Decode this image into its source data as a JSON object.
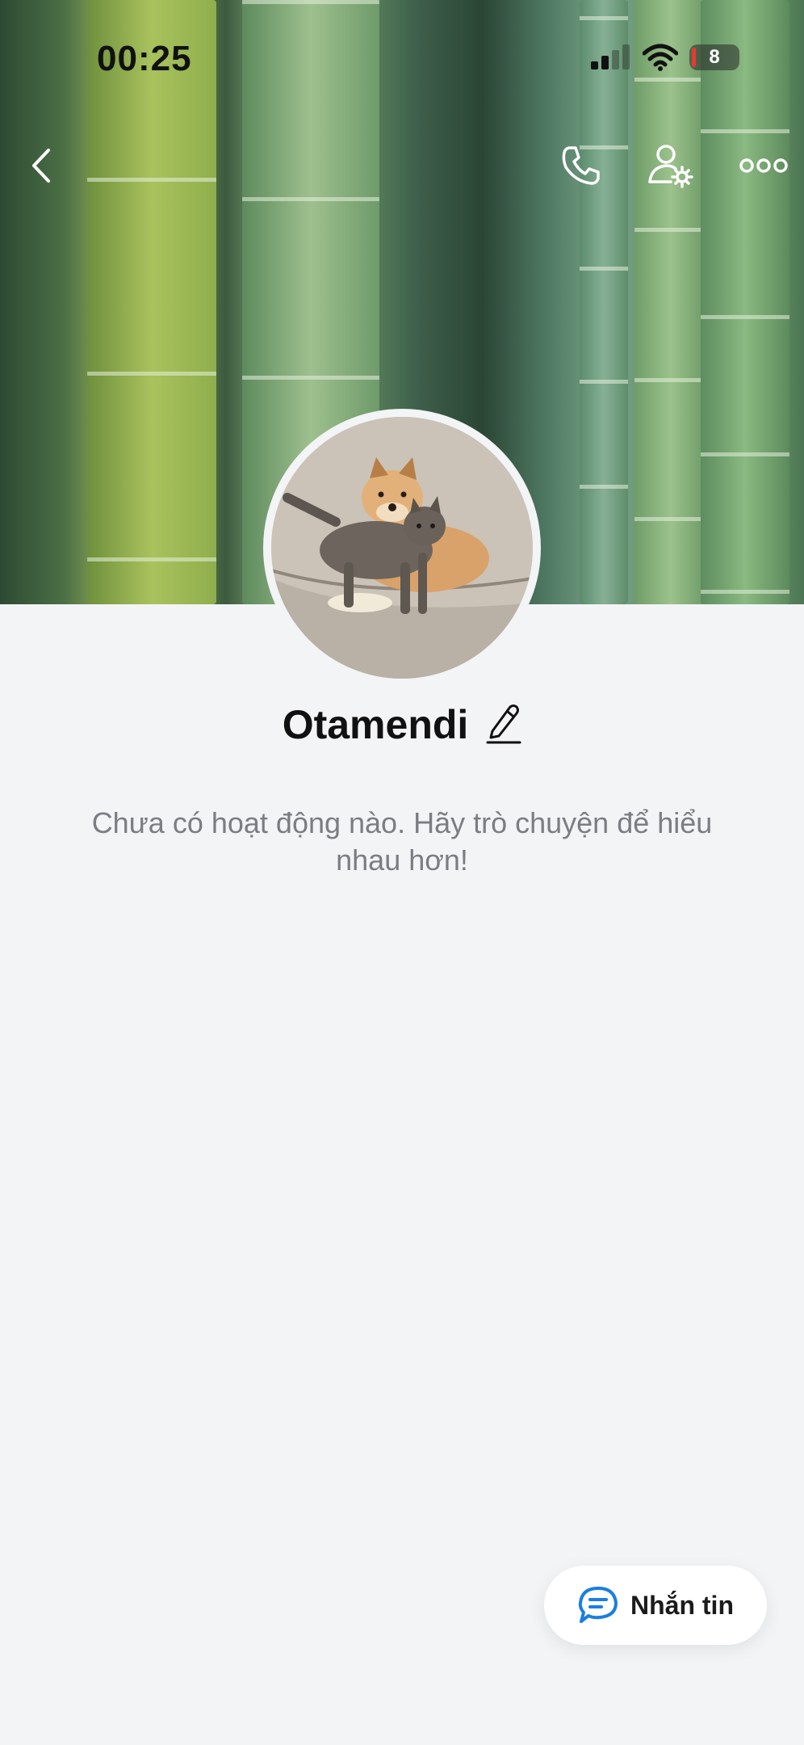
{
  "status_bar": {
    "time": "00:25",
    "battery_level": "8"
  },
  "header": {
    "icons": [
      "back-arrow-icon",
      "phone-icon",
      "user-settings-icon",
      "more-dots-icon"
    ]
  },
  "profile": {
    "name": "Otamendi",
    "empty_message": "Chưa có hoạt động nào. Hãy trò chuyện để hiểu nhau hơn!"
  },
  "actions": {
    "message_label": "Nhắn tin"
  },
  "colors": {
    "background": "#f3f4f6",
    "accent": "#1a7fe0",
    "battery_low": "#e53935"
  }
}
